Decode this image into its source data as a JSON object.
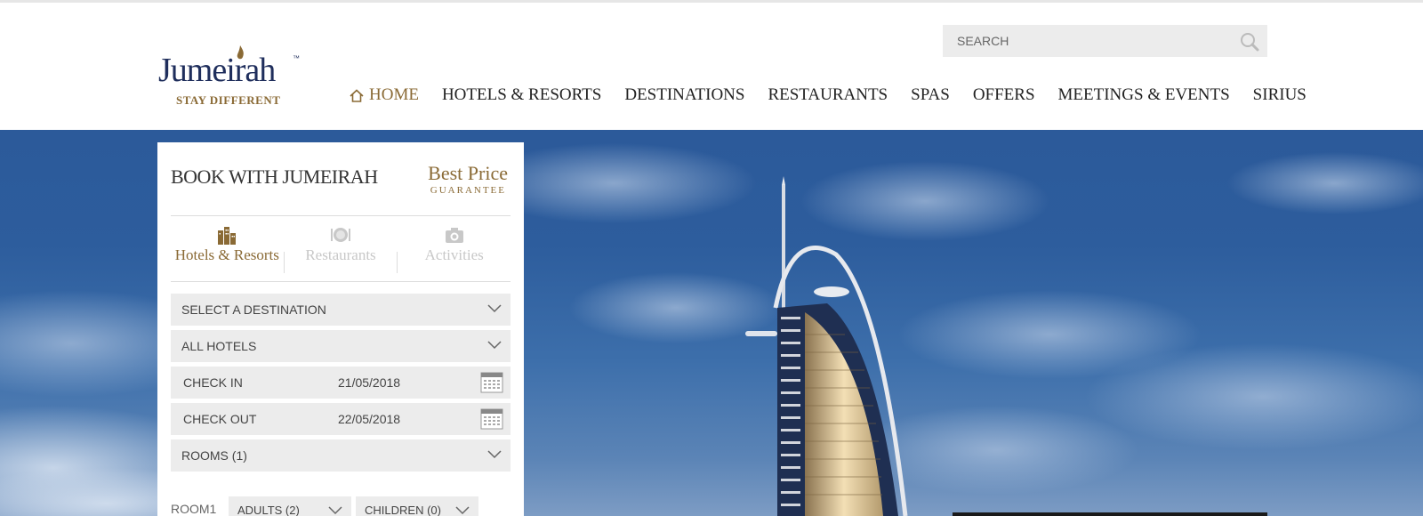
{
  "brand": {
    "name": "Jumeirah",
    "trademark": "™",
    "tagline": "STAY DIFFERENT"
  },
  "search": {
    "placeholder": "SEARCH"
  },
  "nav": [
    {
      "label": "HOME",
      "active": true
    },
    {
      "label": "HOTELS & RESORTS"
    },
    {
      "label": "DESTINATIONS"
    },
    {
      "label": "RESTAURANTS"
    },
    {
      "label": "SPAS"
    },
    {
      "label": "OFFERS"
    },
    {
      "label": "MEETINGS & EVENTS"
    },
    {
      "label": "SIRIUS"
    }
  ],
  "booking": {
    "title": "BOOK WITH JUMEIRAH",
    "best_price": "Best Price",
    "guarantee": "GUARANTEE",
    "tabs": [
      {
        "label": "Hotels & Resorts",
        "icon": "hotel-buildings-icon",
        "active": true
      },
      {
        "label": "Restaurants",
        "icon": "dining-plate-icon"
      },
      {
        "label": "Activities",
        "icon": "camera-icon"
      }
    ],
    "destination": "SELECT A DESTINATION",
    "hotels": "ALL HOTELS",
    "check_in": {
      "label": "CHECK IN",
      "value": "21/05/2018"
    },
    "check_out": {
      "label": "CHECK OUT",
      "value": "22/05/2018"
    },
    "rooms": "ROOMS (1)",
    "room_label": "ROOM1",
    "adults": "ADULTS (2)",
    "children": "CHILDREN (0)"
  },
  "colors": {
    "brand_navy": "#1f2e5c",
    "brand_gold": "#8a6a35",
    "field_bg": "#ececec",
    "sky": "#2d5d9d"
  }
}
